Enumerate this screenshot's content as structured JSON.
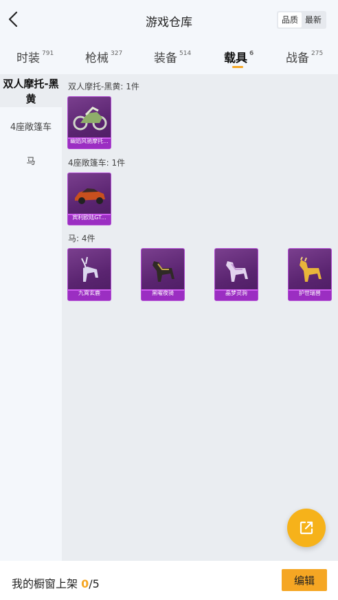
{
  "header": {
    "title": "游戏仓库",
    "sort_options": [
      "品质",
      "最新"
    ]
  },
  "tabs": [
    {
      "label": "时装",
      "count": "791"
    },
    {
      "label": "枪械",
      "count": "327"
    },
    {
      "label": "装备",
      "count": "514"
    },
    {
      "label": "载具",
      "count": "6"
    },
    {
      "label": "战备",
      "count": "275"
    }
  ],
  "sidebar": {
    "items": [
      {
        "label": "双人摩托-黑黄"
      },
      {
        "label": "4座敞篷车"
      },
      {
        "label": "马"
      }
    ]
  },
  "sections": [
    {
      "title": "双人摩托-黑黄: 1件",
      "items": [
        {
          "name": "幽焰风驰摩托..."
        }
      ]
    },
    {
      "title": "4座敞篷车: 1件",
      "items": [
        {
          "name": "宾利欧陆GT..."
        }
      ]
    },
    {
      "title": "马: 4件",
      "items": [
        {
          "name": "九霄玄鹿"
        },
        {
          "name": "黑曜夜骑"
        },
        {
          "name": "晶梦灵驹"
        },
        {
          "name": "护世瑞兽"
        }
      ]
    }
  ],
  "footer": {
    "label_prefix": "我的橱窗上架 ",
    "current": "0",
    "total": "/5",
    "edit_label": "编辑"
  },
  "colors": {
    "accent": "#f5a623",
    "card_border": "#b54fd6",
    "card_bar": "#9b2ec2"
  }
}
